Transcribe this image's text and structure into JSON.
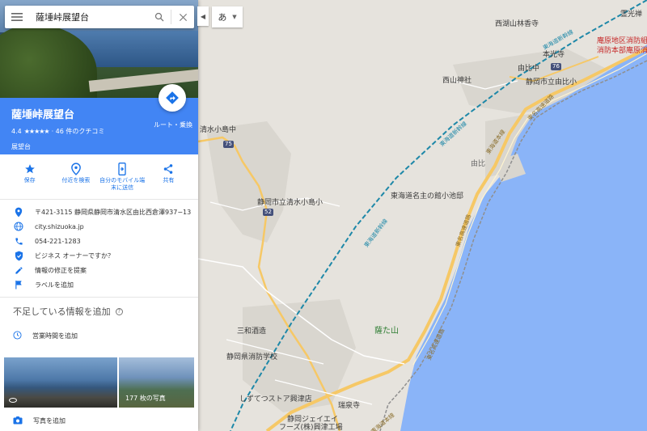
{
  "search": {
    "query": "薩埵峠展望台"
  },
  "ime": {
    "label": "あ"
  },
  "place": {
    "name": "薩埵峠展望台",
    "rating": "4.4",
    "stars": "★★★★★",
    "review_count": "· 46 件のクチコミ",
    "category": "展望台",
    "route_label": "ルート・乗換"
  },
  "actions": [
    {
      "label": "保存",
      "icon": "star-icon"
    },
    {
      "label": "付近を検索",
      "icon": "nearby-pin-icon"
    },
    {
      "label": "自分のモバイル端末に送信",
      "icon": "send-to-phone-icon"
    },
    {
      "label": "共有",
      "icon": "share-icon"
    }
  ],
  "info": {
    "address": "〒421-3115 静岡県静岡市清水区由比西倉澤937−13",
    "website": "city.shizuoka.jp",
    "phone": "054-221-1283",
    "business": "ビジネス オーナーですか？",
    "suggest_edit": "情報の修正を提案",
    "add_label": "ラベルを追加"
  },
  "missing": {
    "title": "不足している情報を追加",
    "hours": "営業時間を追加"
  },
  "photos": {
    "count_label": "177 枚の写真",
    "add_photo": "写真を追加"
  },
  "map": {
    "labels": {
      "nishiko": "西湖山林香寺",
      "reikou": "霊光禅",
      "anbara1": "庵原地区消防組合",
      "anbara2": "消防本部庵原消防署",
      "honkoji": "本光寺",
      "yuiyui": "由比中",
      "nishiyama": "西山神社",
      "yui_elem": "静岡市立由比小",
      "shimizu_oshima_jhs": "清水小島中",
      "shimizu_oshima_elem": "静岡市立清水小島小",
      "yui": "由比",
      "tokaido": "東海道名主の館小池邸",
      "satta": "薩た山",
      "sanwa": "三和酒造",
      "fire_school": "静岡県消防学校",
      "shizutetsu": "しずてつストア興津店",
      "zuisenji": "瑞泉寺",
      "foods1": "静岡ジェイエイ",
      "foods2": "フーズ(株)興津工場"
    },
    "shields": {
      "r76": "76",
      "r75": "75",
      "r52": "52"
    },
    "rail_labels": {
      "shinkansen_a": "東海道新幹線",
      "shinkansen_b": "東海道新幹線",
      "shinkansen_c": "東海道新幹線"
    },
    "hwy_labels": {
      "tomei_a": "東名高速道路",
      "tomei_b": "東名高速道路",
      "tomei_c": "東名高速道路",
      "tokaido_a": "東海道本線",
      "tokaido_b": "東海道本線"
    },
    "colors": {
      "sea": "#8ab4f8",
      "land": "#e6e3dd",
      "urban": "#d9d6cf",
      "rail": "#1e88a8",
      "road_major": "#f6c866",
      "pin": "#db4437"
    }
  }
}
